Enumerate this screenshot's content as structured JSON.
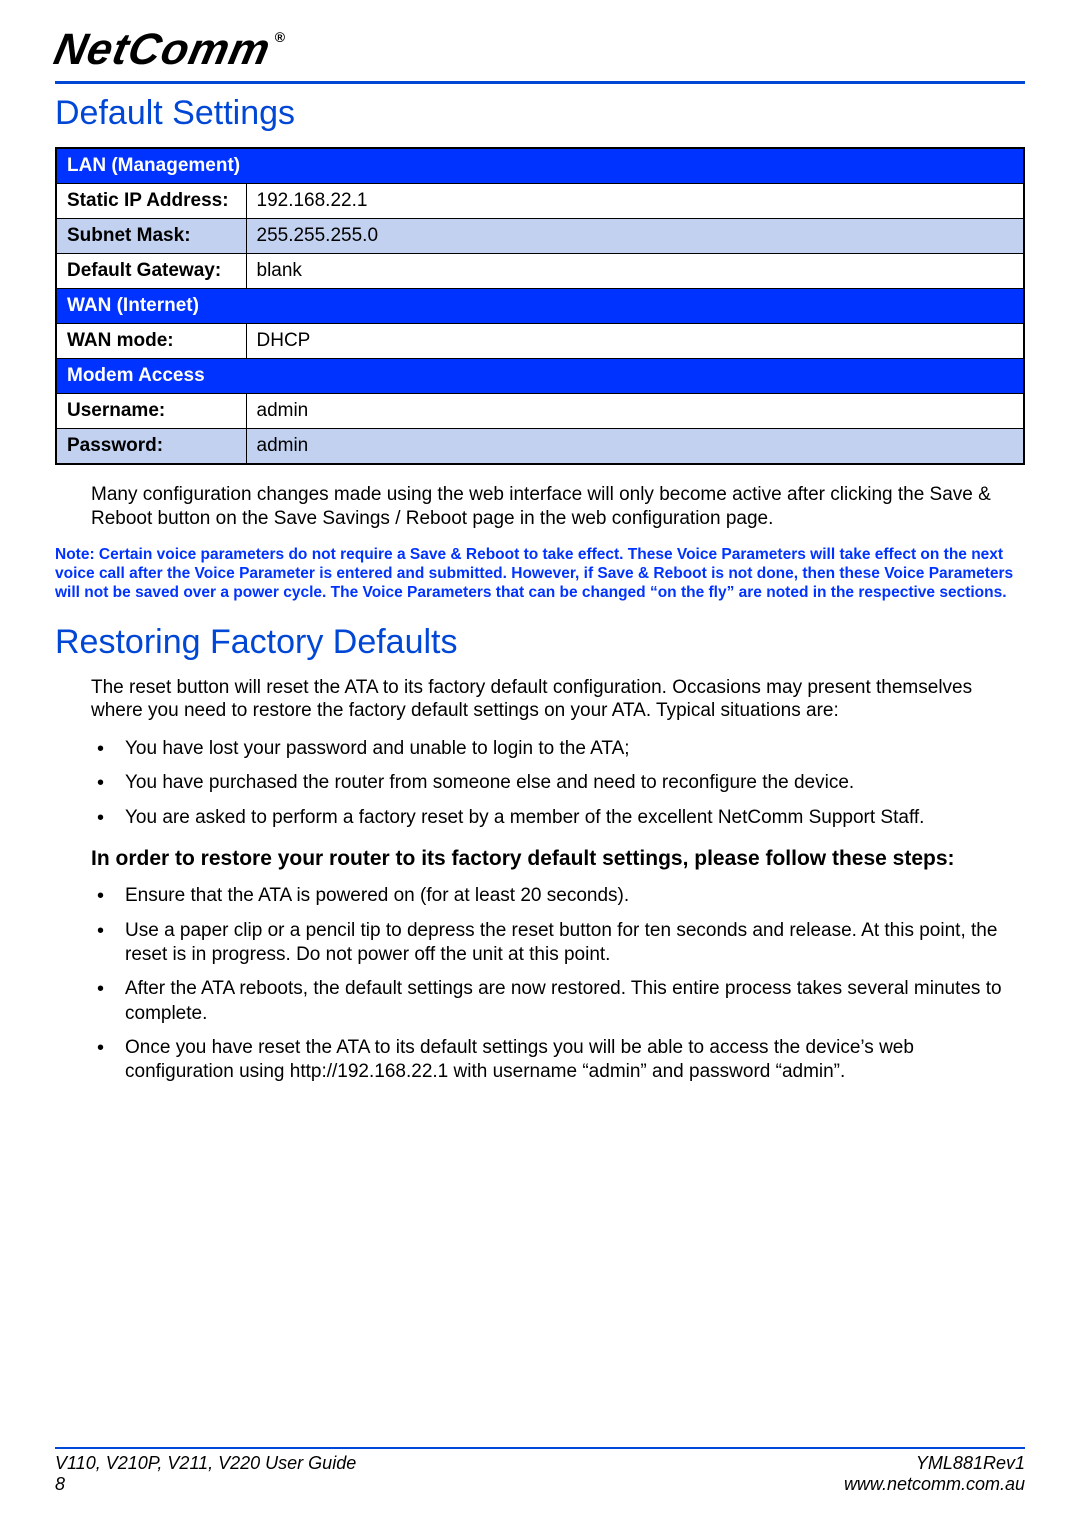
{
  "brand": "NetComm",
  "registered": "®",
  "headings": {
    "default_settings": "Default Settings",
    "restoring": "Restoring Factory Defaults"
  },
  "table": {
    "sections": {
      "lan": "LAN (Management)",
      "wan": "WAN (Internet)",
      "modem": "Modem Access"
    },
    "rows": {
      "static_ip_label": "Static IP Address:",
      "static_ip_value": "192.168.22.1",
      "subnet_label": "Subnet Mask:",
      "subnet_value": "255.255.255.0",
      "gateway_label": "Default Gateway:",
      "gateway_value": "blank",
      "wanmode_label": "WAN mode:",
      "wanmode_value": "DHCP",
      "user_label": "Username:",
      "user_value": "admin",
      "pass_label": "Password:",
      "pass_value": "admin"
    }
  },
  "body": {
    "config_note": "Many configuration changes made using the web interface will only become active after clicking the Save & Reboot button on the Save Savings / Reboot page in the web configuration page.",
    "blue_note": "Note: Certain voice parameters do not require a Save & Reboot to take effect. These Voice Parameters will take effect on the next voice call after the Voice Parameter is entered and submitted. However, if Save & Reboot is not done, then these Voice Parameters will not be saved over a power cycle. The Voice Parameters that can be changed “on the fly” are noted in the respective sections.",
    "reset_intro": "The reset button will reset the ATA to its factory default configuration. Occasions may present themselves where you need to restore the factory default settings on your ATA. Typical situations are:",
    "situations": [
      "You have lost your password and unable to login to the ATA;",
      "You have purchased the router from someone else and need to reconfigure the device.",
      "You are asked to perform a factory reset by a member of the excellent NetComm Support Staff."
    ],
    "steps_heading": "In order to restore your router to its factory default settings, please follow these steps:",
    "steps": [
      "Ensure that the ATA is powered on (for at least 20 seconds).",
      "Use a paper clip or a pencil tip to depress the reset button for ten seconds and release. At this point, the reset is in progress. Do not power off the unit at this point.",
      "After the ATA reboots, the default settings are now restored. This entire process takes several minutes to complete.",
      "Once you have reset the ATA to its default settings you will be able to access the device’s web configuration using http://192.168.22.1 with username “admin” and password “admin”."
    ]
  },
  "footer": {
    "guide": "V110, V210P, V211, V220 User Guide",
    "page": "8",
    "rev": "YML881Rev1",
    "url": "www.netcomm.com.au"
  }
}
